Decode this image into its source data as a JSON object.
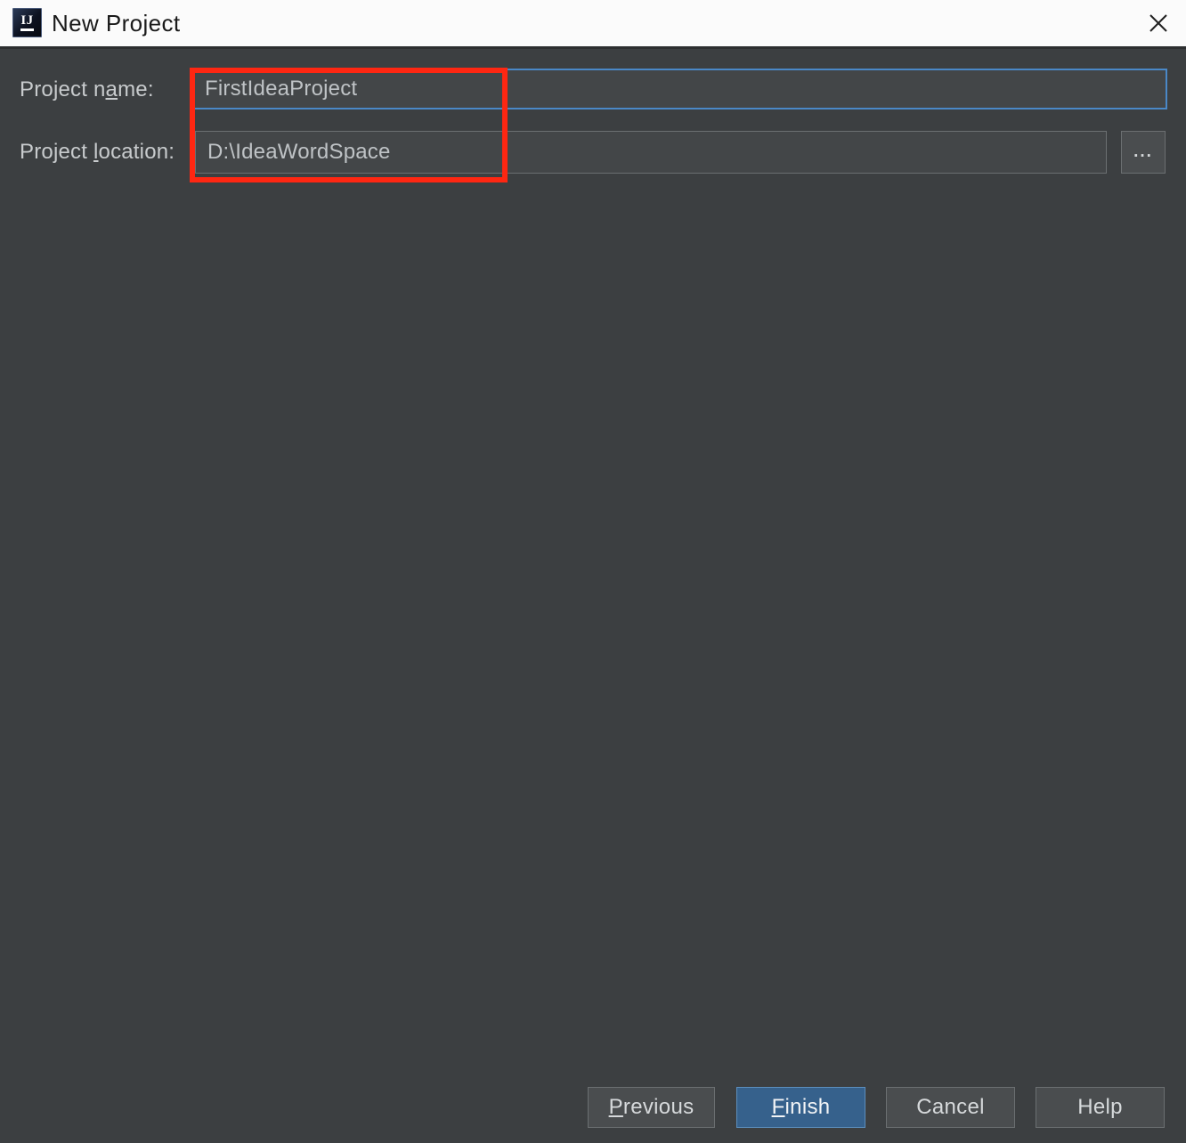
{
  "window": {
    "title": "New Project",
    "app_icon": "intellij-idea-icon",
    "icon_letters": "IJ",
    "close_icon": "close-icon",
    "titlebar_bg": "#fbfbfb",
    "body_bg": "#3c3f41"
  },
  "form": {
    "project_name": {
      "label_prefix": "Project n",
      "label_mnemonic": "a",
      "label_suffix": "me:",
      "label_full": "Project name:",
      "value": "FirstIdeaProject",
      "placeholder": "",
      "focused": true,
      "focus_color": "#4a88c7"
    },
    "project_location": {
      "label_prefix": "Project ",
      "label_mnemonic": "l",
      "label_suffix": "ocation:",
      "label_full": "Project location:",
      "value": "D:\\IdeaWordSpace",
      "placeholder": "",
      "browse_label": "...",
      "browse_icon": "ellipsis-icon"
    }
  },
  "annotation": {
    "type": "highlight-rectangle",
    "color": "#fe2712"
  },
  "buttons": {
    "previous": {
      "mnemonic": "P",
      "rest": "revious",
      "label_full": "Previous",
      "primary": false
    },
    "finish": {
      "mnemonic": "F",
      "rest": "inish",
      "label_full": "Finish",
      "primary": true,
      "color": "#36618c"
    },
    "cancel": {
      "label_full": "Cancel",
      "primary": false
    },
    "help": {
      "label_full": "Help",
      "primary": false
    }
  }
}
